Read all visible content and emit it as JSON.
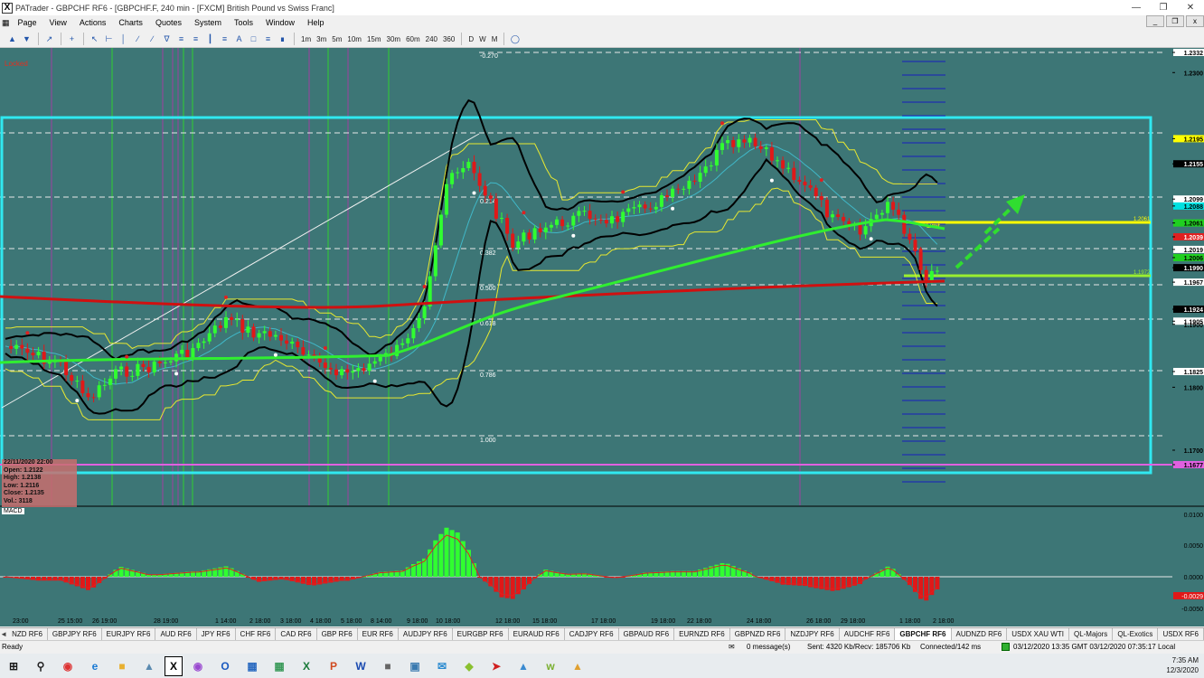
{
  "window": {
    "title": "PATrader - GBPCHF RF6 - [GBPCHF.F, 240 min - [FXCM] British Pound vs Swiss Franc]",
    "app_icon": "X"
  },
  "menu": [
    "Page",
    "View",
    "Actions",
    "Charts",
    "Quotes",
    "System",
    "Tools",
    "Window",
    "Help"
  ],
  "toolbar": {
    "timeframes": [
      "1m",
      "3m",
      "5m",
      "10m",
      "15m",
      "30m",
      "60m",
      "240",
      "360",
      "D",
      "W",
      "M"
    ]
  },
  "chart": {
    "locked_label": "Locked",
    "price_labels": [
      {
        "text": "1.2332",
        "color": "#ffffff",
        "fg": "#000000"
      },
      {
        "text": "1.2300",
        "color": "",
        "fg": "#000000"
      },
      {
        "text": "1.2195",
        "color": "#ffff00",
        "fg": "#000000"
      },
      {
        "text": "1.2155",
        "color": "#000000",
        "fg": "#ffffff"
      },
      {
        "text": "1.2099",
        "color": "#ffffff",
        "fg": "#000000"
      },
      {
        "text": "1.2088",
        "color": "#00e0e0",
        "fg": "#000000"
      },
      {
        "text": "1.2061",
        "color": "#20d020",
        "fg": "#000000"
      },
      {
        "text": "1.2039",
        "color": "#e02020",
        "fg": "#ffffff"
      },
      {
        "text": "1.2019",
        "color": "#ffffff",
        "fg": "#000000"
      },
      {
        "text": "1.2006",
        "color": "#20d020",
        "fg": "#000000"
      },
      {
        "text": "1.1990",
        "color": "#000000",
        "fg": "#ffffff"
      },
      {
        "text": "1.1967",
        "color": "#ffffff",
        "fg": "#000000"
      },
      {
        "text": "1.1924",
        "color": "#000000",
        "fg": "#ffffff"
      },
      {
        "text": "1.1905",
        "color": "#ffffff",
        "fg": "#000000"
      },
      {
        "text": "1.1900",
        "color": "",
        "fg": "#000000"
      },
      {
        "text": "1.1825",
        "color": "#ffffff",
        "fg": "#000000"
      },
      {
        "text": "1.1800",
        "color": "",
        "fg": "#000000"
      },
      {
        "text": "1.1700",
        "color": "",
        "fg": "#000000"
      },
      {
        "text": "1.1677",
        "color": "#e060e0",
        "fg": "#000000"
      }
    ],
    "fib_labels": [
      "-0.270",
      "0.214",
      "0.382",
      "0.500",
      "0.618",
      "0.786",
      "1.000"
    ],
    "limit_label": "Limit",
    "level_label_a": "1.2061",
    "level_label_b": "1.1972",
    "info": {
      "date": "22/11/2020 22:00",
      "open": "Open: 1.2122",
      "high": "High: 1.2138",
      "low": "Low: 1.2116",
      "close": "Close: 1.2135",
      "vol": "Vol.: 3118"
    },
    "macd_label": "MACD",
    "macd_scale": [
      "0.0100",
      "0.0050",
      "0.0000",
      "-0.0050"
    ],
    "macd_current": "-0.0029",
    "time_labels": [
      "23:00",
      "25 15:00",
      "26 19:00",
      "28 19:00",
      "1 14:00",
      "2 18:00",
      "3 18:00",
      "4 18:00",
      "5 18:00",
      "8 14:00",
      "9 18:00",
      "10 18:00",
      "12 18:00",
      "15 18:00",
      "17 18:00",
      "19 18:00",
      "22 18:00",
      "24 18:00",
      "26 18:00",
      "29 18:00",
      "1 18:00",
      "2 18:00"
    ],
    "colors": {
      "bg": "#3d7676",
      "bull": "#30ff30",
      "bear": "#e01818",
      "ma_red": "#d01010",
      "ma_green": "#30ee30",
      "box": "#30e8f0"
    }
  },
  "tabs": {
    "items": [
      "NZD RF6",
      "GBPJPY RF6",
      "EURJPY RF6",
      "AUD RF6",
      "JPY RF6",
      "CHF RF6",
      "CAD RF6",
      "GBP RF6",
      "EUR RF6",
      "AUDJPY RF6",
      "EURGBP RF6",
      "EURAUD RF6",
      "CADJPY RF6",
      "GBPAUD RF6",
      "EURNZD RF6",
      "GBPNZD RF6",
      "NZDJPY RF6",
      "AUDCHF RF6",
      "GBPCHF RF6",
      "AUDNZD RF6",
      "USDX XAU WTI",
      "QL-Majors",
      "QL-Exotics",
      "USDX RF6"
    ],
    "active": "GBPCHF RF6"
  },
  "status": {
    "ready": "Ready",
    "messages": "0 message(s)",
    "traffic": "Sent: 4320 Kb/Recv: 185706 Kb",
    "connection": "Connected/142 ms",
    "times": "03/12/2020 13:35 GMT  03/12/2020 07:35:17 Local"
  },
  "taskbar": {
    "time": "7:35 AM",
    "date": "12/3/2020"
  }
}
